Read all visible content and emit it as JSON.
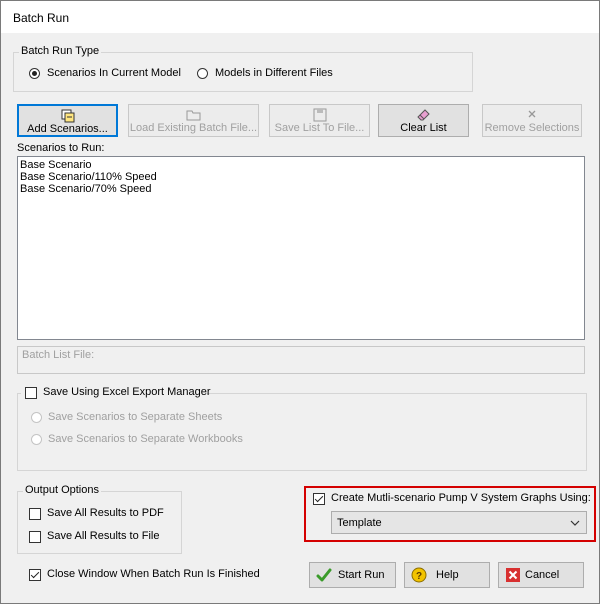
{
  "window": {
    "title": "Batch Run"
  },
  "batch_run_type": {
    "legend": "Batch Run Type",
    "options": [
      {
        "label": "Scenarios In Current Model",
        "selected": true
      },
      {
        "label": "Models in Different Files",
        "selected": false
      }
    ]
  },
  "toolbar": {
    "add_scenarios": "Add Scenarios...",
    "load_batch_file": "Load Existing Batch File...",
    "save_list": "Save List To File...",
    "clear_list": "Clear List",
    "remove_selections": "Remove Selections"
  },
  "scenarios": {
    "label": "Scenarios to Run:",
    "items": [
      "Base Scenario",
      "Base Scenario/110% Speed",
      "Base Scenario/70% Speed"
    ]
  },
  "batch_list_file": {
    "label": "Batch List File:",
    "value": ""
  },
  "excel": {
    "checkbox_label": "Save Using Excel Export Manager",
    "checked": false,
    "options": [
      "Save Scenarios to Separate Sheets",
      "Save Scenarios to Separate Workbooks"
    ]
  },
  "output_options": {
    "legend": "Output Options",
    "pdf_label": "Save All Results to PDF",
    "pdf_checked": false,
    "file_label": "Save All Results to File",
    "file_checked": false
  },
  "graphs": {
    "checkbox_label": "Create Mutli-scenario Pump V System Graphs Using:",
    "checked": true,
    "selected": "Template",
    "highlight_color": "#d40000"
  },
  "close_window": {
    "label": "Close Window When Batch Run Is Finished",
    "checked": true
  },
  "actions": {
    "start_run": "Start Run",
    "help": "Help",
    "cancel": "Cancel"
  },
  "colors": {
    "focus": "#0078d7",
    "check_green": "#3a9b2a",
    "cancel_red": "#d83030",
    "help_yellow": "#f2c300"
  }
}
